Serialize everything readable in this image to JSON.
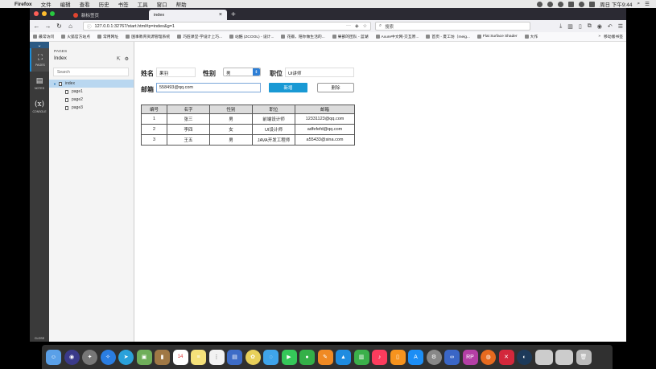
{
  "menubar": {
    "app": "Firefox",
    "items": [
      "文件",
      "编辑",
      "查看",
      "历史",
      "书签",
      "工具",
      "窗口",
      "帮助"
    ],
    "clock": "周日 下午9:44"
  },
  "tabs": [
    {
      "title": "新标签页"
    },
    {
      "title": "index"
    }
  ],
  "nav": {
    "url": "127.0.0.1:32767/start.html#p=index&g=1",
    "search_placeholder": "搜索"
  },
  "bookmarks": {
    "items": [
      "最常访问",
      "火狐官方站点",
      "常用网址",
      "国事教育资源管理系统",
      "巧匠课堂-学设计上巧...",
      "站酷 (ZCOOL) - 设计...",
      "花瓣，陪你做生活的...",
      "果部的团队 - 蓝湖",
      "Axure中文网-交互原...",
      "首页 - 夏工坊（meig...",
      "Flat Surface Shader",
      "大作"
    ],
    "other": "移动版书签"
  },
  "rail": {
    "pages": "PAGES",
    "notes": "NOTES",
    "console": "CONSOLE",
    "close": "CLOSE"
  },
  "panel": {
    "label": "PAGES",
    "title": "Index",
    "search_placeholder": "Search",
    "tree": [
      {
        "label": "index"
      },
      {
        "label": "page1"
      },
      {
        "label": "page2"
      },
      {
        "label": "page3"
      }
    ]
  },
  "form": {
    "name_label": "姓名",
    "name_value": "果羽",
    "gender_label": "性别",
    "gender_value": "男",
    "position_label": "职位",
    "position_value": "UI讲师",
    "email_label": "邮箱",
    "email_value": "558493@qq.com",
    "add_button": "新增",
    "delete_button": "删除"
  },
  "table": {
    "columns": [
      "编号",
      "名字",
      "性别",
      "职位",
      "邮箱"
    ],
    "rows": [
      [
        "1",
        "张三",
        "男",
        "前端设计师",
        "12331123@qq.com"
      ],
      [
        "2",
        "李四",
        "女",
        "UI设计师",
        "adfefefd@qq.com"
      ],
      [
        "3",
        "王五",
        "男",
        "JAVA开发工程师",
        "a55433@sina.com"
      ]
    ]
  },
  "dock": {
    "calendar_day": "14"
  }
}
